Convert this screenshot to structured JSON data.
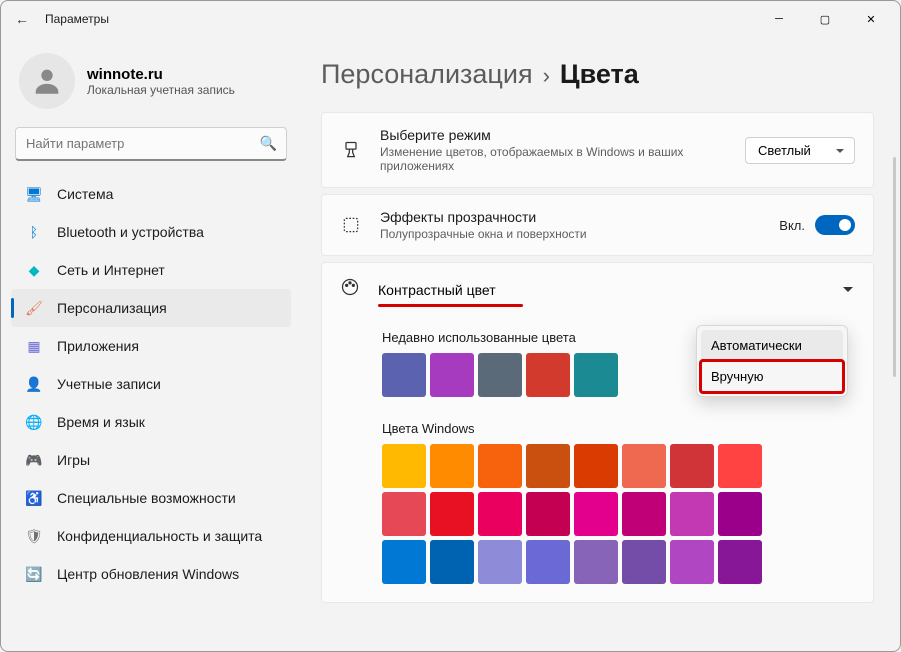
{
  "window": {
    "title": "Параметры"
  },
  "account": {
    "name": "winnote.ru",
    "type": "Локальная учетная запись"
  },
  "search": {
    "placeholder": "Найти параметр"
  },
  "nav": [
    {
      "icon": "display-icon",
      "color": "#0078d4",
      "glyph": "🖥",
      "label": "Система"
    },
    {
      "icon": "bluetooth-icon",
      "color": "#0078d4",
      "glyph": "ᛒ",
      "label": "Bluetooth и устройства"
    },
    {
      "icon": "network-icon",
      "color": "#00b7c3",
      "glyph": "◆",
      "label": "Сеть и Интернет"
    },
    {
      "icon": "personalization-icon",
      "color": "#e3734e",
      "glyph": "🖌",
      "label": "Персонализация"
    },
    {
      "icon": "apps-icon",
      "color": "#6b69d6",
      "glyph": "▦",
      "label": "Приложения"
    },
    {
      "icon": "accounts-icon",
      "color": "#e3008c",
      "glyph": "👤",
      "label": "Учетные записи"
    },
    {
      "icon": "time-icon",
      "color": "#5e4a8f",
      "glyph": "🌐",
      "label": "Время и язык"
    },
    {
      "icon": "gaming-icon",
      "color": "#767676",
      "glyph": "🎮",
      "label": "Игры"
    },
    {
      "icon": "accessibility-icon",
      "color": "#0099bc",
      "glyph": "♿",
      "label": "Специальные возможности"
    },
    {
      "icon": "privacy-icon",
      "color": "#746f6e",
      "glyph": "🛡",
      "label": "Конфиденциальность и защита"
    },
    {
      "icon": "update-icon",
      "color": "#0078d4",
      "glyph": "🔄",
      "label": "Центр обновления Windows"
    }
  ],
  "breadcrumb": {
    "parent": "Персонализация",
    "current": "Цвета"
  },
  "cards": {
    "mode": {
      "title": "Выберите режим",
      "subtitle": "Изменение цветов, отображаемых в Windows и ваших приложениях",
      "value": "Светлый"
    },
    "transparency": {
      "title": "Эффекты прозрачности",
      "subtitle": "Полупрозрачные окна и поверхности",
      "state": "Вкл."
    },
    "accent": {
      "title": "Контрастный цвет"
    }
  },
  "dropdown": {
    "opt1": "Автоматически",
    "opt2": "Вручную"
  },
  "recent": {
    "title": "Недавно использованные цвета",
    "colors": [
      "#5b63b0",
      "#a63bc0",
      "#5a6a78",
      "#d13a2d",
      "#1b8a93"
    ]
  },
  "windows_colors": {
    "title": "Цвета Windows",
    "colors": [
      "#ffb900",
      "#ff8c00",
      "#f7630c",
      "#ca5010",
      "#da3b01",
      "#ef6950",
      "#d13438",
      "#ff4343",
      "#e74856",
      "#e81123",
      "#ea005e",
      "#c30052",
      "#e3008c",
      "#bf0077",
      "#c239b3",
      "#9a0089",
      "#0078d4",
      "#0063b1",
      "#8e8cd8",
      "#6b69d6",
      "#8764b8",
      "#744da9",
      "#b146c2",
      "#881798"
    ]
  }
}
